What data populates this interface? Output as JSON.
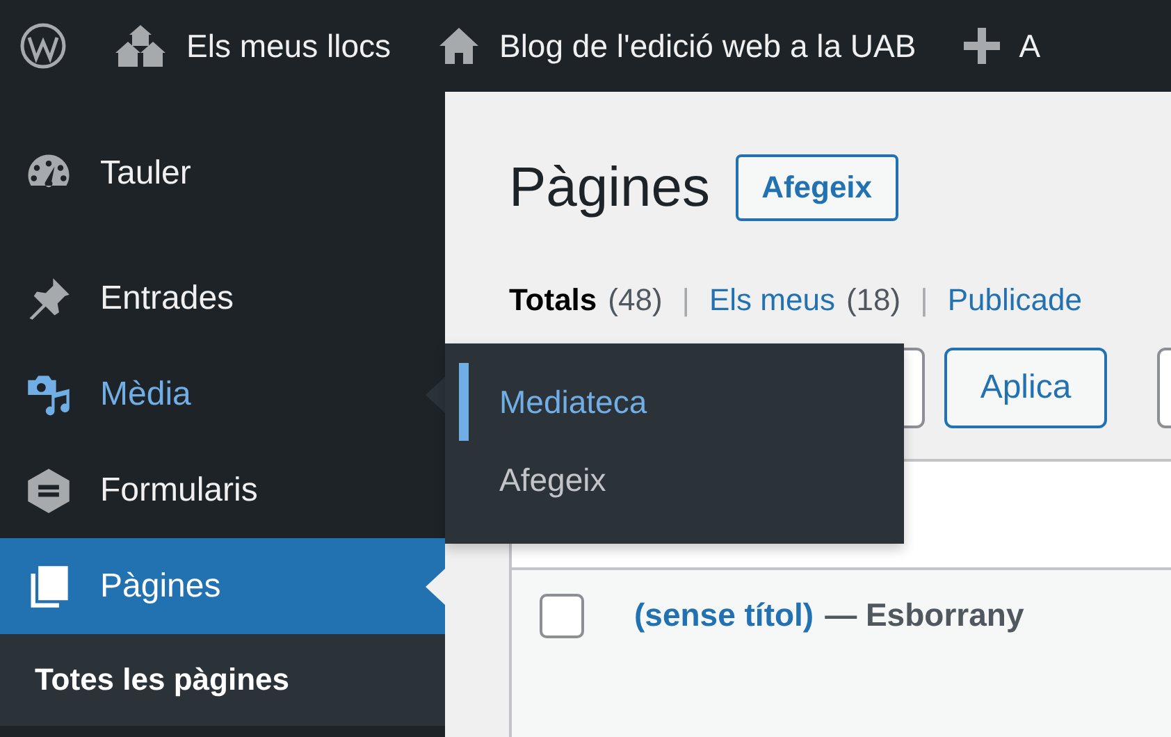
{
  "admin_bar": {
    "items": [
      {
        "kind": "logo"
      },
      {
        "kind": "sites",
        "label": "Els meus llocs"
      },
      {
        "kind": "home",
        "label": "Blog de l'edició web a la UAB"
      },
      {
        "kind": "new",
        "label": "A"
      }
    ]
  },
  "sidebar": {
    "items": [
      {
        "kind": "dashboard",
        "label": "Tauler",
        "selected": false,
        "highlighted": false
      },
      {
        "kind": "pin",
        "label": "Entrades",
        "selected": false,
        "highlighted": false
      },
      {
        "kind": "media",
        "label": "Mèdia",
        "selected": false,
        "highlighted": true,
        "flyout": [
          {
            "label": "Mediateca",
            "selected": true
          },
          {
            "label": "Afegeix",
            "selected": false
          }
        ]
      },
      {
        "kind": "forms",
        "label": "Formularis",
        "selected": false,
        "highlighted": false
      },
      {
        "kind": "pages",
        "label": "Pàgines",
        "selected": true,
        "highlighted": false,
        "submenu": [
          {
            "label": "Totes les pàgines",
            "selected": true
          }
        ]
      }
    ]
  },
  "content": {
    "title": "Pàgines",
    "add_button": "Afegeix",
    "filters": [
      {
        "label": "Totals",
        "count": "(48)",
        "selected": true
      },
      {
        "separator": "|",
        "label": "Els meus",
        "count": "(18)",
        "selected": false
      },
      {
        "separator": "|",
        "label": "Publicade",
        "selected": false
      }
    ],
    "bulk": {
      "apply_button": "Aplica"
    },
    "table": {
      "rows": [
        {
          "checked": false,
          "title": "(sense títol)",
          "state": "— Esborrany"
        }
      ]
    }
  }
}
